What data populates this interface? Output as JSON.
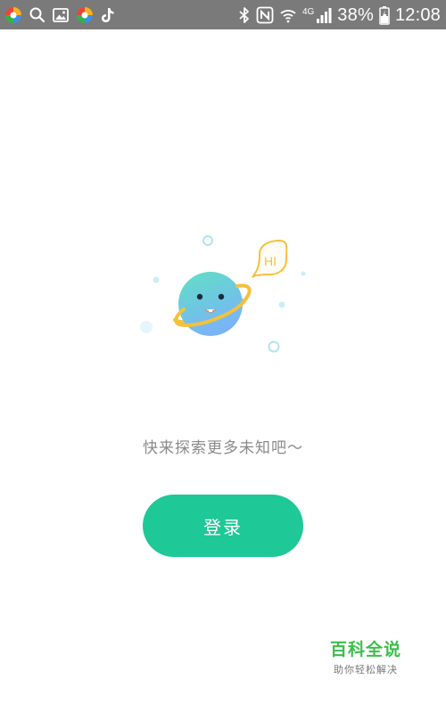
{
  "status_bar": {
    "left_icons": [
      "app-logo-icon",
      "search-icon",
      "gallery-icon",
      "app-logo-icon",
      "tiktok-icon"
    ],
    "right_icons": [
      "bluetooth-icon",
      "nfc-icon",
      "wifi-icon",
      "signal-icon",
      "battery-charging-icon"
    ],
    "network_label": "4G",
    "battery_percent": "38%",
    "time": "12:08"
  },
  "illustration": {
    "bubble_text": "HI",
    "colors": {
      "planet_top": "#5fe0c4",
      "planet_bottom": "#7ab4f7",
      "ring": "#f5c13b",
      "bubble": "#f5c13b",
      "sparkle": "#aee4f4"
    }
  },
  "main": {
    "prompt_text": "快来探索更多未知吧～",
    "login_label": "登录"
  },
  "watermark": {
    "title": "百科全说",
    "subtitle": "助你轻松解决"
  },
  "colors": {
    "status_bar_bg": "#7a7a7a",
    "primary": "#1fc897",
    "prompt_text": "#8a8a8a",
    "watermark_green": "#3bbf4a"
  }
}
